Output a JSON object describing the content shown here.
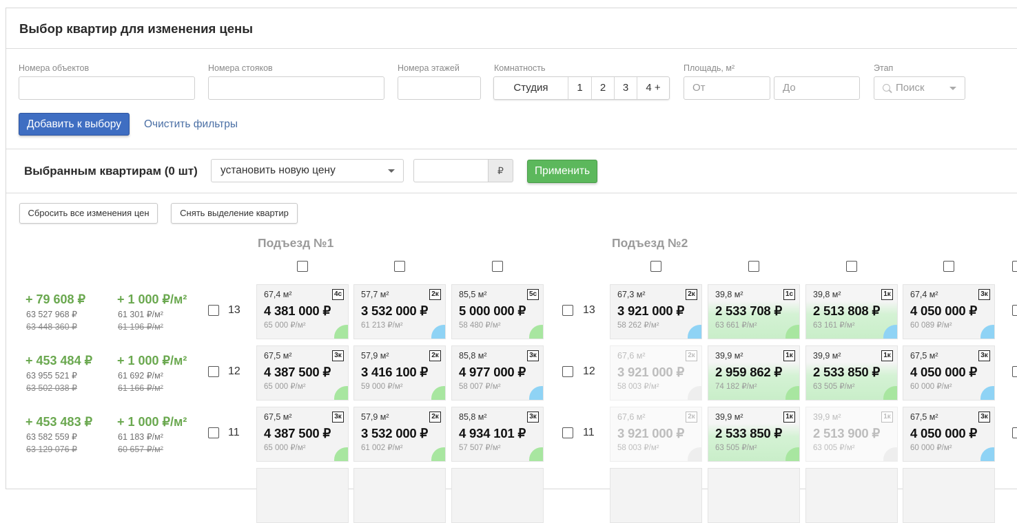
{
  "title": "Выбор квартир для изменения цены",
  "filters": {
    "objects_label": "Номера объектов",
    "risers_label": "Номера стояков",
    "floors_label": "Номера этажей",
    "rooms_label": "Комнатность",
    "rooms": [
      "Студия",
      "1",
      "2",
      "3",
      "4 +"
    ],
    "area_label": "Площадь, м²",
    "area_from": "От",
    "area_to": "До",
    "stage_label": "Этап",
    "stage_placeholder": "Поиск",
    "add_button": "Добавить к выбору",
    "clear_link": "Очистить фильтры"
  },
  "bulk": {
    "label": "Выбранным квартирам (0 шт)",
    "action": "установить новую цену",
    "currency": "₽",
    "apply": "Применить",
    "reset_prices": "Сбросить все изменения цен",
    "deselect": "Снять выделение квартир"
  },
  "entrances": [
    "Подъезд №1",
    "Подъезд №2"
  ],
  "floors": [
    {
      "floor": "13",
      "sum_delta": "+ 79 608 ₽",
      "sum_new": "63 527 968 ₽",
      "sum_old": "63 448 360 ₽",
      "sqm_delta": "+ 1 000 ₽/м²",
      "sqm_new": "61 301 ₽/м²",
      "sqm_old": "61 196 ₽/м²",
      "e1": [
        {
          "area": "67,4 м²",
          "type": "4с",
          "price": "4 381 000 ₽",
          "per_m2": "65 000 ₽/м²",
          "corner": "#a8e6a0"
        },
        {
          "area": "57,7 м²",
          "type": "2к",
          "price": "3 532 000 ₽",
          "per_m2": "61 213 ₽/м²",
          "corner": "#8fd3f5"
        },
        {
          "area": "85,5 м²",
          "type": "5с",
          "price": "5 000 000 ₽",
          "per_m2": "58 480 ₽/м²",
          "corner": "#a8e6a0"
        }
      ],
      "e2": [
        {
          "area": "67,3 м²",
          "type": "2к",
          "price": "3 921 000 ₽",
          "per_m2": "58 262 ₽/м²",
          "corner": "#8fd3f5"
        },
        {
          "area": "39,8 м²",
          "type": "1с",
          "price": "2 533 708 ₽",
          "per_m2": "63 661 ₽/м²",
          "corner": "#a8e6a0"
        },
        {
          "area": "39,8 м²",
          "type": "1к",
          "price": "2 513 808 ₽",
          "per_m2": "63 161 ₽/м²",
          "corner": "#8fd3f5"
        },
        {
          "area": "67,4 м²",
          "type": "3к",
          "price": "4 050 000 ₽",
          "per_m2": "60 089 ₽/м²",
          "corner": "#8fd3f5"
        }
      ]
    },
    {
      "floor": "12",
      "sum_delta": "+ 453 484 ₽",
      "sum_new": "63 955 521 ₽",
      "sum_old": "63 502 038 ₽",
      "sqm_delta": "+ 1 000 ₽/м²",
      "sqm_new": "61 692 ₽/м²",
      "sqm_old": "61 166 ₽/м²",
      "e1": [
        {
          "area": "67,5 м²",
          "type": "3к",
          "price": "4 387 500 ₽",
          "per_m2": "65 000 ₽/м²",
          "corner": "#a8e6a0"
        },
        {
          "area": "57,9 м²",
          "type": "2к",
          "price": "3 416 100 ₽",
          "per_m2": "59 000 ₽/м²",
          "corner": "#a8e6a0"
        },
        {
          "area": "85,8 м²",
          "type": "3к",
          "price": "4 977 000 ₽",
          "per_m2": "58 007 ₽/м²",
          "corner": "#8fd3f5"
        }
      ],
      "e2": [
        {
          "area": "67,6 м²",
          "type": "2к",
          "price": "3 921 000 ₽",
          "per_m2": "58 003 ₽/м²",
          "corner": "#eeeeee",
          "dim": true
        },
        {
          "area": "39,9 м²",
          "type": "1к",
          "price": "2 959 862 ₽",
          "per_m2": "74 182 ₽/м²",
          "corner": "#a8e6a0"
        },
        {
          "area": "39,9 м²",
          "type": "1к",
          "price": "2 533 850 ₽",
          "per_m2": "63 505 ₽/м²",
          "corner": "#a8e6a0"
        },
        {
          "area": "67,5 м²",
          "type": "3к",
          "price": "4 050 000 ₽",
          "per_m2": "60 000 ₽/м²",
          "corner": "#8fd3f5"
        }
      ]
    },
    {
      "floor": "11",
      "sum_delta": "+ 453 483 ₽",
      "sum_new": "63 582 559 ₽",
      "sum_old": "63 129 076 ₽",
      "sqm_delta": "+ 1 000 ₽/м²",
      "sqm_new": "61 183 ₽/м²",
      "sqm_old": "60 657 ₽/м²",
      "e1": [
        {
          "area": "67,5 м²",
          "type": "3к",
          "price": "4 387 500 ₽",
          "per_m2": "65 000 ₽/м²",
          "corner": "#a8e6a0"
        },
        {
          "area": "57,9 м²",
          "type": "2к",
          "price": "3 532 000 ₽",
          "per_m2": "61 002 ₽/м²",
          "corner": "#a8e6a0"
        },
        {
          "area": "85,8 м²",
          "type": "3к",
          "price": "4 934 101 ₽",
          "per_m2": "57 507 ₽/м²",
          "corner": "#a8e6a0"
        }
      ],
      "e2": [
        {
          "area": "67,6 м²",
          "type": "2к",
          "price": "3 921 000 ₽",
          "per_m2": "58 003 ₽/м²",
          "corner": "#eeeeee",
          "dim": true
        },
        {
          "area": "39,9 м²",
          "type": "1к",
          "price": "2 533 850 ₽",
          "per_m2": "63 505 ₽/м²",
          "corner": "#a8e6a0"
        },
        {
          "area": "39,9 м²",
          "type": "1к",
          "price": "2 513 900 ₽",
          "per_m2": "63 005 ₽/м²",
          "corner": "#eeeeee",
          "dim": true
        },
        {
          "area": "67,5 м²",
          "type": "3к",
          "price": "4 050 000 ₽",
          "per_m2": "60 000 ₽/м²",
          "corner": "#8fd3f5"
        }
      ]
    }
  ],
  "green_cards": [
    [
      1,
      2
    ],
    [
      1,
      2
    ],
    [
      1
    ]
  ]
}
